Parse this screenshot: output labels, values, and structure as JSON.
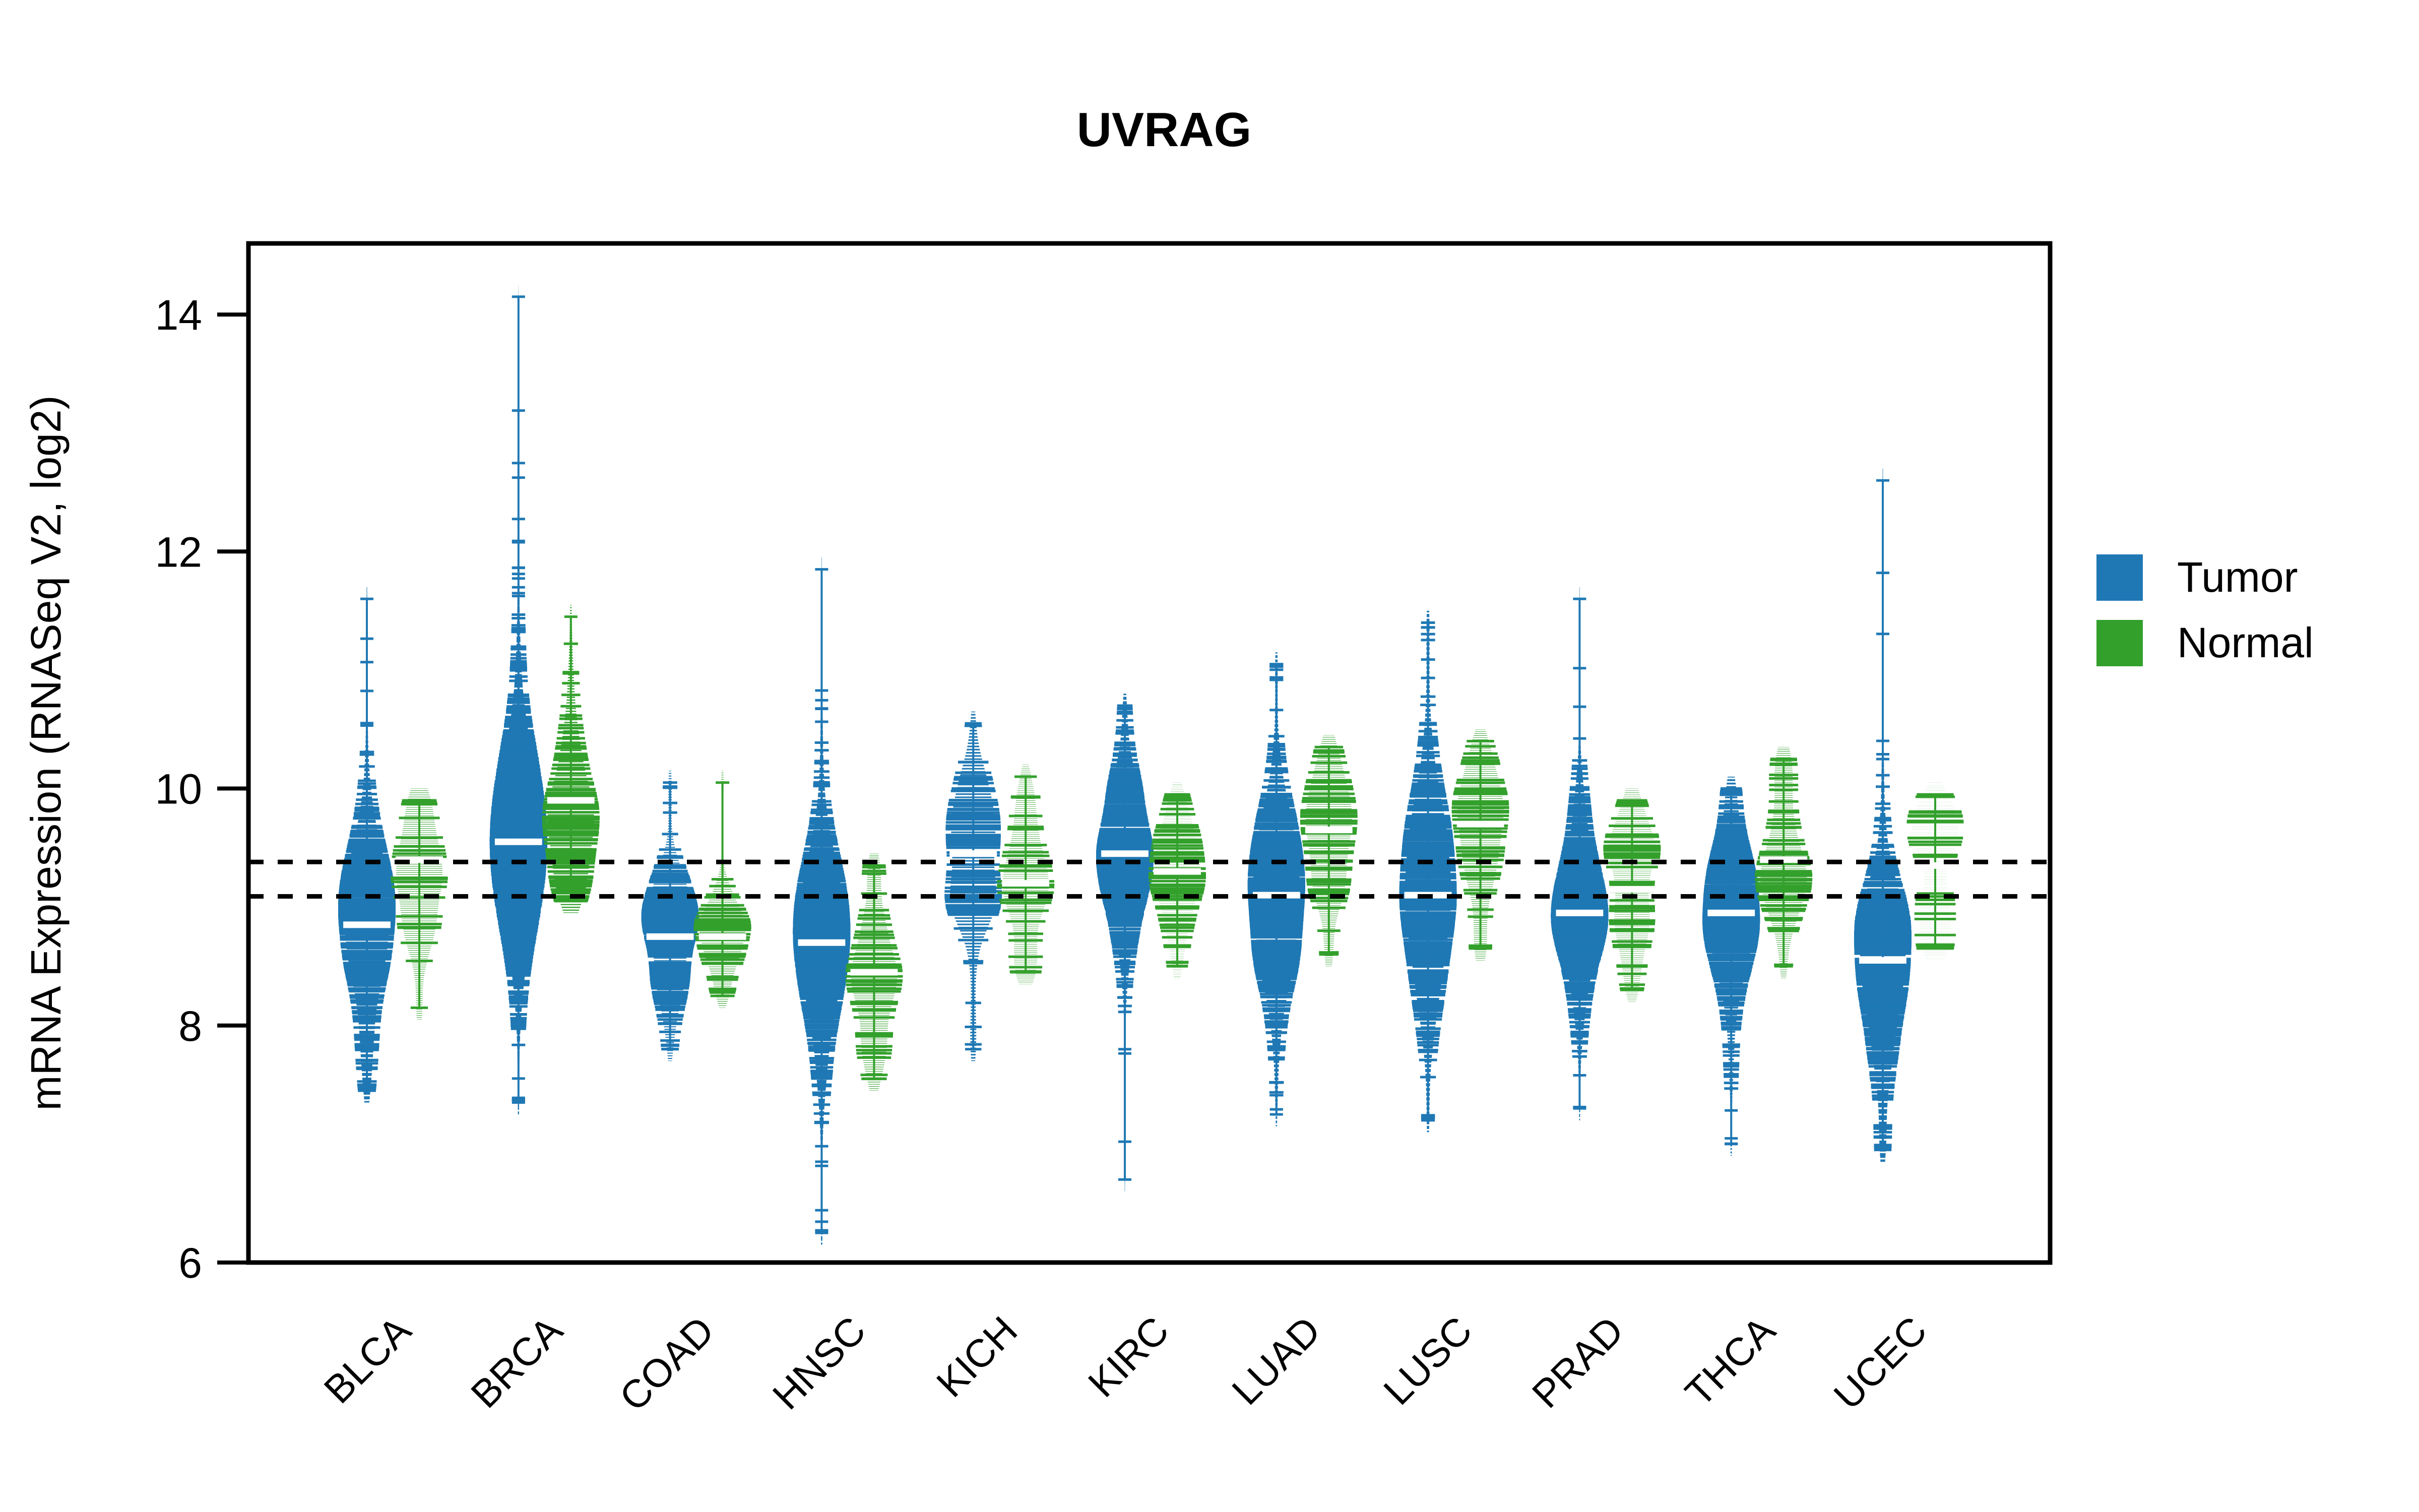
{
  "chart_data": {
    "type": "violin",
    "title": "UVRAG",
    "xlabel": "",
    "ylabel": "mRNA Expression (RNASeq V2, log2)",
    "ylim": [
      6,
      14.6
    ],
    "yticks": [
      6,
      8,
      10,
      12,
      14
    ],
    "ytick_labels": [
      "6",
      "8",
      "10",
      "12",
      "14"
    ],
    "grid": false,
    "legend_position": "right",
    "reference_lines": [
      9.38,
      9.09
    ],
    "categories": [
      "BLCA",
      "BRCA",
      "COAD",
      "HNSC",
      "KICH",
      "KIRC",
      "LUAD",
      "LUSC",
      "PRAD",
      "THCA",
      "UCEC"
    ],
    "series": [
      {
        "name": "Tumor",
        "color": "#1f78b4",
        "stats": [
          {
            "category": "BLCA",
            "median": 8.85,
            "q1": 8.55,
            "q3": 9.3,
            "min": 7.45,
            "max": 11.6,
            "whisker_low": 7.45,
            "whisker_high": 10.75
          },
          {
            "category": "BRCA",
            "median": 9.55,
            "q1": 9.1,
            "q3": 9.95,
            "min": 7.35,
            "max": 14.15,
            "whisker_low": 7.35,
            "whisker_high": 12.2
          },
          {
            "category": "COAD",
            "median": 8.75,
            "q1": 8.5,
            "q3": 9.05,
            "min": 7.8,
            "max": 10.05,
            "whisker_low": 7.8,
            "whisker_high": 9.75
          },
          {
            "category": "HNSC",
            "median": 8.7,
            "q1": 8.35,
            "q3": 9.15,
            "min": 6.25,
            "max": 11.85,
            "whisker_low": 6.25,
            "whisker_high": 10.9
          },
          {
            "category": "KICH",
            "median": 9.45,
            "q1": 9.15,
            "q3": 9.8,
            "min": 7.8,
            "max": 10.55,
            "whisker_low": 7.8,
            "whisker_high": 10.4
          },
          {
            "category": "KIRC",
            "median": 9.45,
            "q1": 9.15,
            "q3": 9.75,
            "min": 6.7,
            "max": 10.7,
            "whisker_low": 7.35,
            "whisker_high": 10.6
          },
          {
            "category": "LUAD",
            "median": 9.1,
            "q1": 8.7,
            "q3": 9.45,
            "min": 7.25,
            "max": 11.05,
            "whisker_low": 7.25,
            "whisker_high": 10.4
          },
          {
            "category": "LUSC",
            "median": 9.1,
            "q1": 8.6,
            "q3": 9.45,
            "min": 7.2,
            "max": 11.4,
            "whisker_low": 7.2,
            "whisker_high": 10.8
          },
          {
            "category": "PRAD",
            "median": 8.95,
            "q1": 8.65,
            "q3": 9.3,
            "min": 7.3,
            "max": 11.6,
            "whisker_low": 7.3,
            "whisker_high": 10.8
          },
          {
            "category": "THCA",
            "median": 8.95,
            "q1": 8.65,
            "q3": 9.25,
            "min": 7.0,
            "max": 10.0,
            "whisker_low": 7.0,
            "whisker_high": 9.95
          },
          {
            "category": "UCEC",
            "median": 8.55,
            "q1": 8.3,
            "q3": 9.0,
            "min": 6.95,
            "max": 12.6,
            "whisker_low": 6.95,
            "whisker_high": 11.05
          }
        ]
      },
      {
        "name": "Normal",
        "color": "#33a02c",
        "stats": [
          {
            "category": "BLCA",
            "median": 9.4,
            "q1": 9.05,
            "q3": 9.65,
            "min": 8.15,
            "max": 9.9,
            "whisker_low": 8.15,
            "whisker_high": 9.9
          },
          {
            "category": "BRCA",
            "median": 9.9,
            "q1": 9.6,
            "q3": 10.2,
            "min": 9.05,
            "max": 11.45,
            "whisker_low": 9.05,
            "whisker_high": 11.45
          },
          {
            "category": "COAD",
            "median": 8.75,
            "q1": 8.55,
            "q3": 8.95,
            "min": 8.25,
            "max": 10.05,
            "whisker_low": 8.25,
            "whisker_high": 9.4
          },
          {
            "category": "HNSC",
            "median": 8.45,
            "q1": 8.25,
            "q3": 8.8,
            "min": 7.55,
            "max": 9.35,
            "whisker_low": 7.55,
            "whisker_high": 9.35
          },
          {
            "category": "KICH",
            "median": 9.2,
            "q1": 8.95,
            "q3": 9.45,
            "min": 8.45,
            "max": 10.1,
            "whisker_low": 8.45,
            "whisker_high": 10.1
          },
          {
            "category": "KIRC",
            "median": 9.3,
            "q1": 9.05,
            "q3": 9.55,
            "min": 8.5,
            "max": 9.95,
            "whisker_low": 8.5,
            "whisker_high": 9.95
          },
          {
            "category": "LUAD",
            "median": 9.65,
            "q1": 9.35,
            "q3": 9.95,
            "min": 8.6,
            "max": 10.35,
            "whisker_low": 8.6,
            "whisker_high": 10.35
          },
          {
            "category": "LUSC",
            "median": 9.7,
            "q1": 9.4,
            "q3": 10.0,
            "min": 8.65,
            "max": 10.4,
            "whisker_low": 8.65,
            "whisker_high": 10.4
          },
          {
            "category": "PRAD",
            "median": 9.15,
            "q1": 8.9,
            "q3": 9.45,
            "min": 8.3,
            "max": 9.9,
            "whisker_low": 8.3,
            "whisker_high": 9.9
          },
          {
            "category": "THCA",
            "median": 9.4,
            "q1": 9.1,
            "q3": 9.7,
            "min": 8.5,
            "max": 10.25,
            "whisker_low": 8.5,
            "whisker_high": 10.25
          },
          {
            "category": "UCEC",
            "median": 9.35,
            "q1": 9.1,
            "q3": 9.6,
            "min": 8.65,
            "max": 9.95,
            "whisker_low": 8.65,
            "whisker_high": 9.95
          }
        ]
      }
    ]
  },
  "title": "UVRAG",
  "axes": {
    "y_label": "mRNA Expression (RNASeq V2, log2)",
    "y_tick_labels": [
      "6",
      "8",
      "10",
      "12",
      "14"
    ],
    "x_tick_labels": [
      "BLCA",
      "BRCA",
      "COAD",
      "HNSC",
      "KICH",
      "KIRC",
      "LUAD",
      "LUSC",
      "PRAD",
      "THCA",
      "UCEC"
    ]
  },
  "legend": {
    "items": [
      {
        "label": "Tumor",
        "color": "#1f78b4"
      },
      {
        "label": "Normal",
        "color": "#33a02c"
      }
    ]
  },
  "colors": {
    "tumor": "#1f78b4",
    "normal": "#33a02c",
    "axis": "#000000",
    "background": "#ffffff"
  }
}
